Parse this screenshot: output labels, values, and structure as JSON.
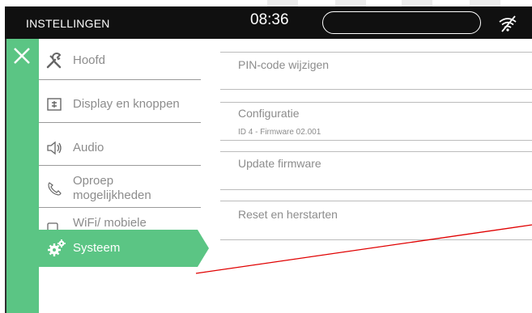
{
  "header": {
    "title": "INSTELLINGEN",
    "time": "08:36"
  },
  "menu": {
    "items": [
      {
        "label": "Hoofd",
        "icon": "tools-icon"
      },
      {
        "label": "Display en knoppen",
        "icon": "display-buttons-icon"
      },
      {
        "label": "Audio",
        "icon": "speaker-icon"
      },
      {
        "label": "Oproep mogelijkheden",
        "icon": "phone-icon"
      },
      {
        "label": "WiFi/ mobiele toestellen",
        "icon": "mobile-devices-icon"
      },
      {
        "label": "Systeem",
        "icon": "gears-icon"
      }
    ],
    "active_index": 5
  },
  "content": {
    "rows": [
      {
        "label": "PIN-code wijzigen"
      },
      {
        "label": "Configuratie",
        "detail": "ID 4 - Firmware 02.001"
      },
      {
        "label": "Update firmware"
      },
      {
        "label": "Reset en herstarten"
      }
    ]
  },
  "colors": {
    "accent": "#5bc584",
    "topbar": "#101010",
    "text": "#8c8c8c",
    "annotation": "#e00000"
  }
}
